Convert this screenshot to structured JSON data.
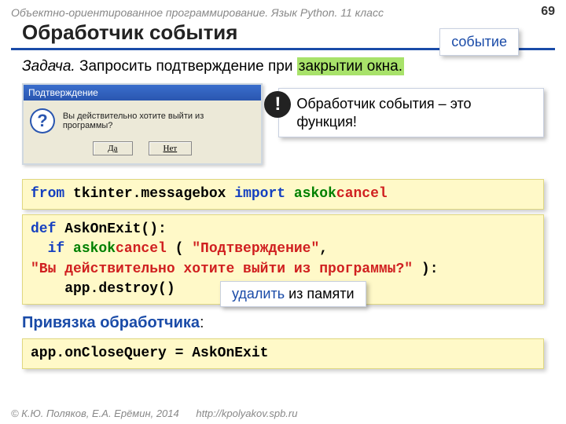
{
  "header": "Объектно-ориентированное программирование. Язык Python. 11 класс",
  "page": "69",
  "title": "Обработчик события",
  "event_label": "событие",
  "task_prefix": "Задача.",
  "task_body": " Запросить подтверждение при ",
  "task_hl": "закрытии окна.",
  "dialog": {
    "title": "Подтверждение",
    "text": "Вы действительно хотите выйти из программы?",
    "yes": "Да",
    "no": "Нет"
  },
  "note": "Обработчик события – это функция!",
  "bang": "!",
  "code1": {
    "from": "from",
    "pkg": " tkinter.messagebox ",
    "import": "import",
    "ask": " askok",
    "cancel": "cancel"
  },
  "code2": {
    "def": "def",
    "fn": " AskOnExit():",
    "if": "if",
    "ask": " askok",
    "cancel": "cancel",
    "open": " ( ",
    "arg1": "\"Подтверждение\"",
    "comma": ",",
    "arg2": "\"Вы действительно хотите выйти из программы?\"",
    "close": " ):",
    "body": "    app.destroy()"
  },
  "del_note_b": "удалить",
  "del_note_r": " из памяти",
  "bind_title": "Привязка обработчика",
  "bind_colon": ":",
  "code3": "app.onCloseQuery = AskOnExit",
  "footer_c": "© К.Ю. Поляков, Е.А. Ерёмин, 2014",
  "footer_u": "http://kpolyakov.spb.ru"
}
